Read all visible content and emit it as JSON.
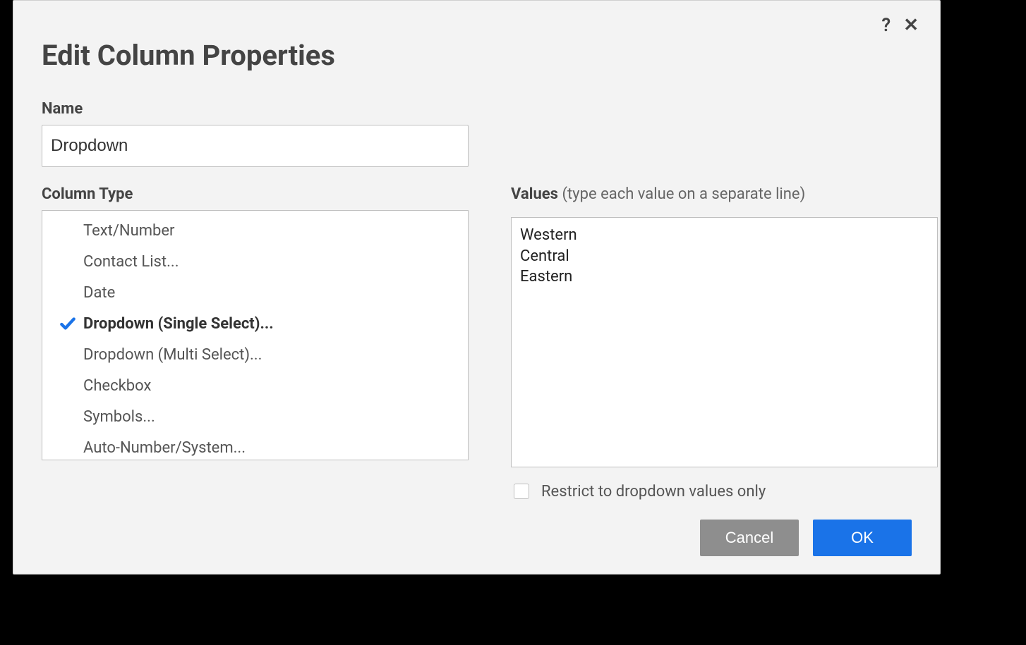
{
  "dialog": {
    "title": "Edit Column Properties",
    "help_icon": "?",
    "close_icon": "✕"
  },
  "name_field": {
    "label": "Name",
    "value": "Dropdown"
  },
  "column_type": {
    "label": "Column Type",
    "selected_index": 3,
    "items": [
      "Text/Number",
      "Contact List...",
      "Date",
      "Dropdown (Single Select)...",
      "Dropdown (Multi Select)...",
      "Checkbox",
      "Symbols...",
      "Auto-Number/System..."
    ]
  },
  "values_field": {
    "label": "Values",
    "hint": "(type each value on a separate line)",
    "value": "Western\nCentral\nEastern"
  },
  "restrict": {
    "label": "Restrict to dropdown values only",
    "checked": false
  },
  "buttons": {
    "cancel": "Cancel",
    "ok": "OK"
  },
  "colors": {
    "primary": "#1a73e8",
    "secondary": "#8e8e8e",
    "check": "#1a73e8"
  }
}
